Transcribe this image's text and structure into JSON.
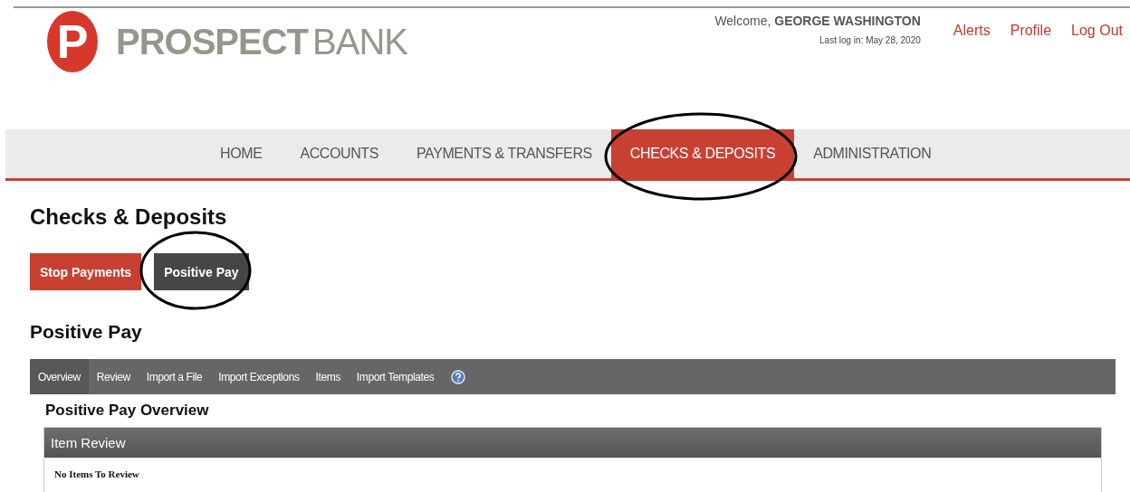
{
  "logo": {
    "mark": "P",
    "brand_bold": "PROSPECT",
    "brand_light": "BANK"
  },
  "user": {
    "welcome": "Welcome,",
    "name": "GEORGE WASHINGTON",
    "last_login": "Last log in: May 28, 2020"
  },
  "top_links": [
    "Alerts",
    "Profile",
    "Log Out"
  ],
  "nav": [
    {
      "label": "HOME",
      "selected": false,
      "circled": false
    },
    {
      "label": "ACCOUNTS",
      "selected": false,
      "circled": false
    },
    {
      "label": "PAYMENTS & TRANSFERS",
      "selected": false,
      "circled": false
    },
    {
      "label": "CHECKS & DEPOSITS",
      "selected": true,
      "circled": true
    },
    {
      "label": "ADMINISTRATION",
      "selected": false,
      "circled": false
    }
  ],
  "page_title": "Checks & Deposits",
  "sub_tabs": [
    {
      "label": "Stop Payments",
      "selected": false,
      "circled": false
    },
    {
      "label": "Positive Pay",
      "selected": true,
      "circled": true
    }
  ],
  "section_title": "Positive Pay",
  "section_tabs": [
    {
      "label": "Overview",
      "selected": true
    },
    {
      "label": "Review",
      "selected": false
    },
    {
      "label": "Import a File",
      "selected": false
    },
    {
      "label": "Import Exceptions",
      "selected": false
    },
    {
      "label": "Items",
      "selected": false
    },
    {
      "label": "Import Templates",
      "selected": false
    }
  ],
  "overview_title": "Positive Pay Overview",
  "panel": {
    "title": "Item Review",
    "message": "No Items To Review"
  }
}
